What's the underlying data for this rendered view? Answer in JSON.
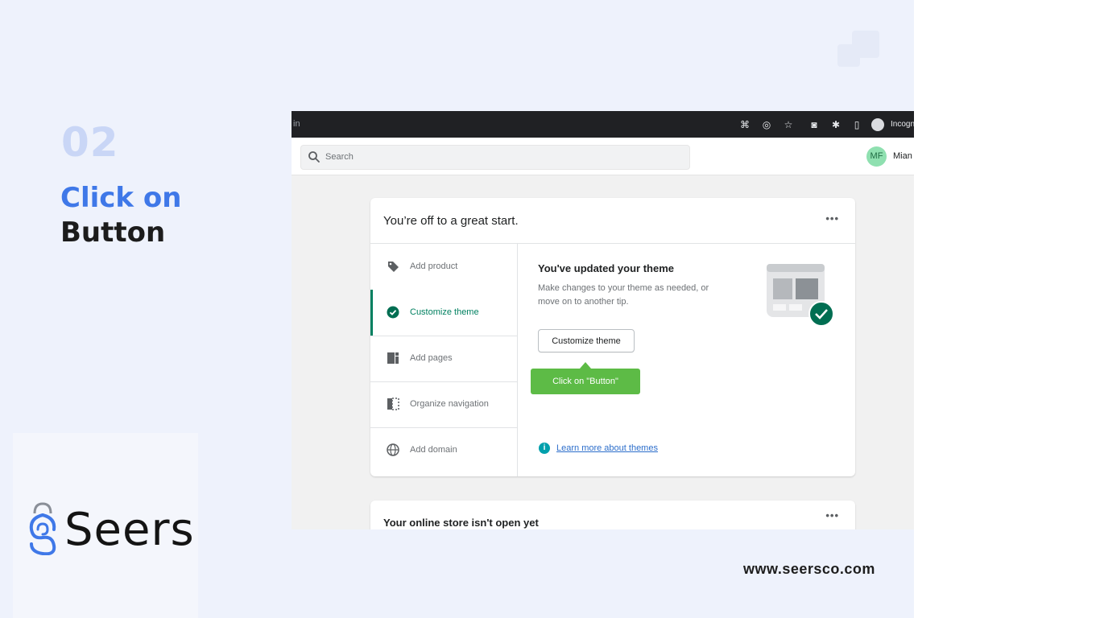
{
  "slide": {
    "step_number": "02",
    "title_line1": "Click on",
    "title_line2": "Button",
    "brand_name": "Seers",
    "website": "www.seersco.com"
  },
  "browser": {
    "tab_fragment": "in",
    "profile_label": "Incognito",
    "icons": [
      "qr-code-icon",
      "eye-off-icon",
      "star-icon",
      "camera-icon",
      "puzzle-icon",
      "side-panel-icon",
      "incognito-icon"
    ]
  },
  "app": {
    "search_placeholder": "Search",
    "user_initials": "MF",
    "user_name": "Mian"
  },
  "setup_card": {
    "title": "You’re off to a great start.",
    "menu": "•••",
    "steps": [
      {
        "label": "Add product",
        "icon": "tag-icon",
        "active": false
      },
      {
        "label": "Customize theme",
        "icon": "check-circle-icon",
        "active": true
      },
      {
        "label": "Add pages",
        "icon": "pages-icon",
        "active": false
      },
      {
        "label": "Organize navigation",
        "icon": "navigation-icon",
        "active": false
      },
      {
        "label": "Add domain",
        "icon": "globe-icon",
        "active": false
      }
    ],
    "detail": {
      "title": "You've updated your theme",
      "description": "Make changes to your theme as needed, or move on to another tip.",
      "button_label": "Customize theme",
      "tooltip": "Click on \"Button\"",
      "learn_more": "Learn more about themes"
    }
  },
  "store_card": {
    "title": "Your online store isn't open yet",
    "menu": "•••"
  },
  "colors": {
    "accent_blue": "#3f78e8",
    "shopify_green": "#008060",
    "tooltip_green": "#5dbb46",
    "background": "#eef2fc"
  }
}
